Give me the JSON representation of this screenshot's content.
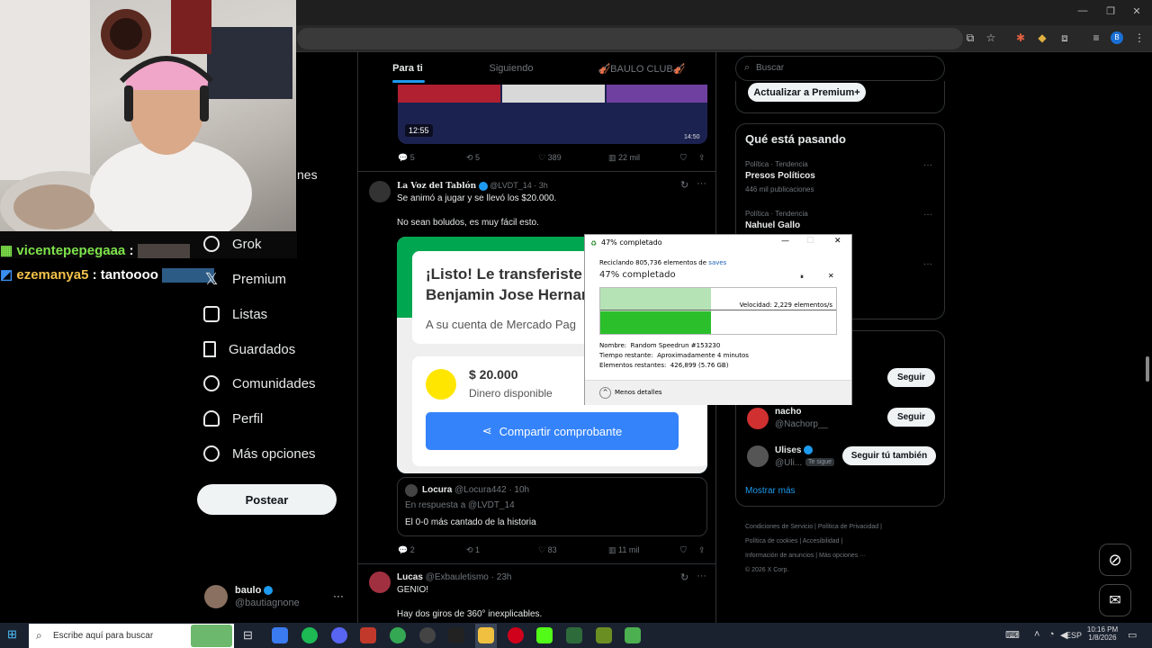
{
  "window": {
    "minimize": "—",
    "restore": "❐",
    "close": "✕"
  },
  "chat": [
    {
      "user": "vicentepepegaaa",
      "sep": ":"
    },
    {
      "user": "ezemanya5",
      "sep": ":",
      "msg": "tantoooo"
    }
  ],
  "nav": {
    "partial_label": "nes",
    "items": [
      "Grok",
      "Premium",
      "Listas",
      "Guardados",
      "Comunidades",
      "Perfil",
      "Más opciones"
    ],
    "post_label": "Postear",
    "account": {
      "name": "baulo",
      "handle": "@bautiagnone",
      "more": "···"
    }
  },
  "tabs": [
    "Para ti",
    "Siguiendo",
    "🎻BAULO CLUB🎻"
  ],
  "video": {
    "duration": "12:55",
    "duration2": "14:50"
  },
  "tweet0_actions": {
    "replies": "5",
    "retweets": "5",
    "likes": "389",
    "views": "22 mil"
  },
  "tweet1": {
    "name": "La Voz del Tablón",
    "handle": "@LVDT_14",
    "time": "· 3h",
    "text1": "Se animó a jugar y se llevó los $20.000.",
    "text2": "No sean boludos, es muy fácil esto.",
    "card": {
      "title": "¡Listo! Le transferiste a",
      "name": "Benjamin Jose Hernan",
      "subtitle": "A su cuenta de Mercado Pag",
      "amount": "$ 20.000",
      "amount_label": "Dinero disponible",
      "share": "Compartir comprobante"
    },
    "quote": {
      "name": "Locura",
      "handle": "@Locura442",
      "time": "· 10h",
      "reply_to": "En respuesta a @LVDT_14",
      "text": "El 0-0 más cantado de la historia"
    },
    "actions": {
      "replies": "2",
      "retweets": "1",
      "likes": "83",
      "views": "11 mil"
    }
  },
  "tweet2": {
    "name": "Lucas",
    "handle": "@Exbauletismo",
    "time": "· 23h",
    "text1": "GENIO!",
    "text2": "Hay dos giros de 360° inexplicables."
  },
  "right": {
    "search_placeholder": "Buscar",
    "premium_btn": "Actualizar a Premium+",
    "trends_title": "Qué está pasando",
    "trends": [
      {
        "meta": "Política · Tendencia",
        "title": "Presos Políticos",
        "count": "446 mil publicaciones"
      },
      {
        "meta": "Política · Tendencia",
        "title": "Nahuel Gallo"
      }
    ],
    "follow": [
      {
        "btn": "Seguir"
      },
      {
        "name": "nacho",
        "handle": "@Nachorp__",
        "btn": "Seguir"
      },
      {
        "name": "Ulises",
        "handle": "@Uli...",
        "badge": "Te sigue",
        "btn": "Seguir tú también"
      }
    ],
    "show_more": "Mostrar más",
    "footer": [
      "Condiciones de Servicio",
      "Política de Privacidad",
      "Política de cookies",
      "Accesibilidad",
      "Información de anuncios",
      "Más opciones ···",
      "© 2026 X Corp."
    ]
  },
  "dialog": {
    "title": "47% completado",
    "line1_prefix": "Reciclando 805,736 elementos de",
    "line1_link": "saves",
    "big": "47% completado",
    "speed": "Velocidad: 2,229 elementos/s",
    "progress": 0.47,
    "name_label": "Nombre:",
    "name_value": "Random Speedrun #153230",
    "time_label": "Tiempo restante:",
    "time_value": "Aproximadamente 4 minutos",
    "items_label": "Elementos restantes:",
    "items_value": "426,899 (5.76 GB)",
    "less_details": "Menos detalles"
  },
  "taskbar": {
    "search_placeholder": "Escribe aquí para buscar",
    "lang": "ESP",
    "time": "10:16 PM",
    "date": "1/8/2026"
  }
}
